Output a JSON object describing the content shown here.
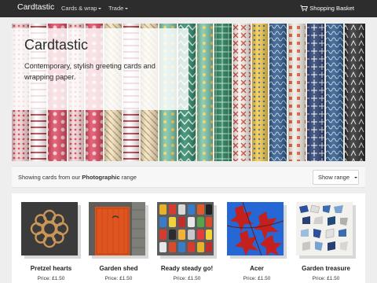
{
  "navbar": {
    "brand": "Cardtastic",
    "menu": [
      {
        "label": "Cards & wrap"
      },
      {
        "label": "Trade"
      }
    ],
    "basket_label": "Shopping Basket"
  },
  "hero": {
    "title": "Cardtastic",
    "subtitle": "Contemporary, stylish greeting cards and wrapping paper."
  },
  "filter": {
    "prefix": "Showing cards from our",
    "range_name": "Photographic",
    "suffix": "range",
    "button_label": "Show range"
  },
  "cards": [
    {
      "name": "Pretzel hearts",
      "price": "Price: £1.50"
    },
    {
      "name": "Garden shed",
      "price": "Price: £1.50"
    },
    {
      "name": "Ready steady go!",
      "price": "Price: £1.50"
    },
    {
      "name": "Acer",
      "price": "Price: £1.50"
    },
    {
      "name": "Garden treasure",
      "price": "Price: £1.50"
    }
  ]
}
